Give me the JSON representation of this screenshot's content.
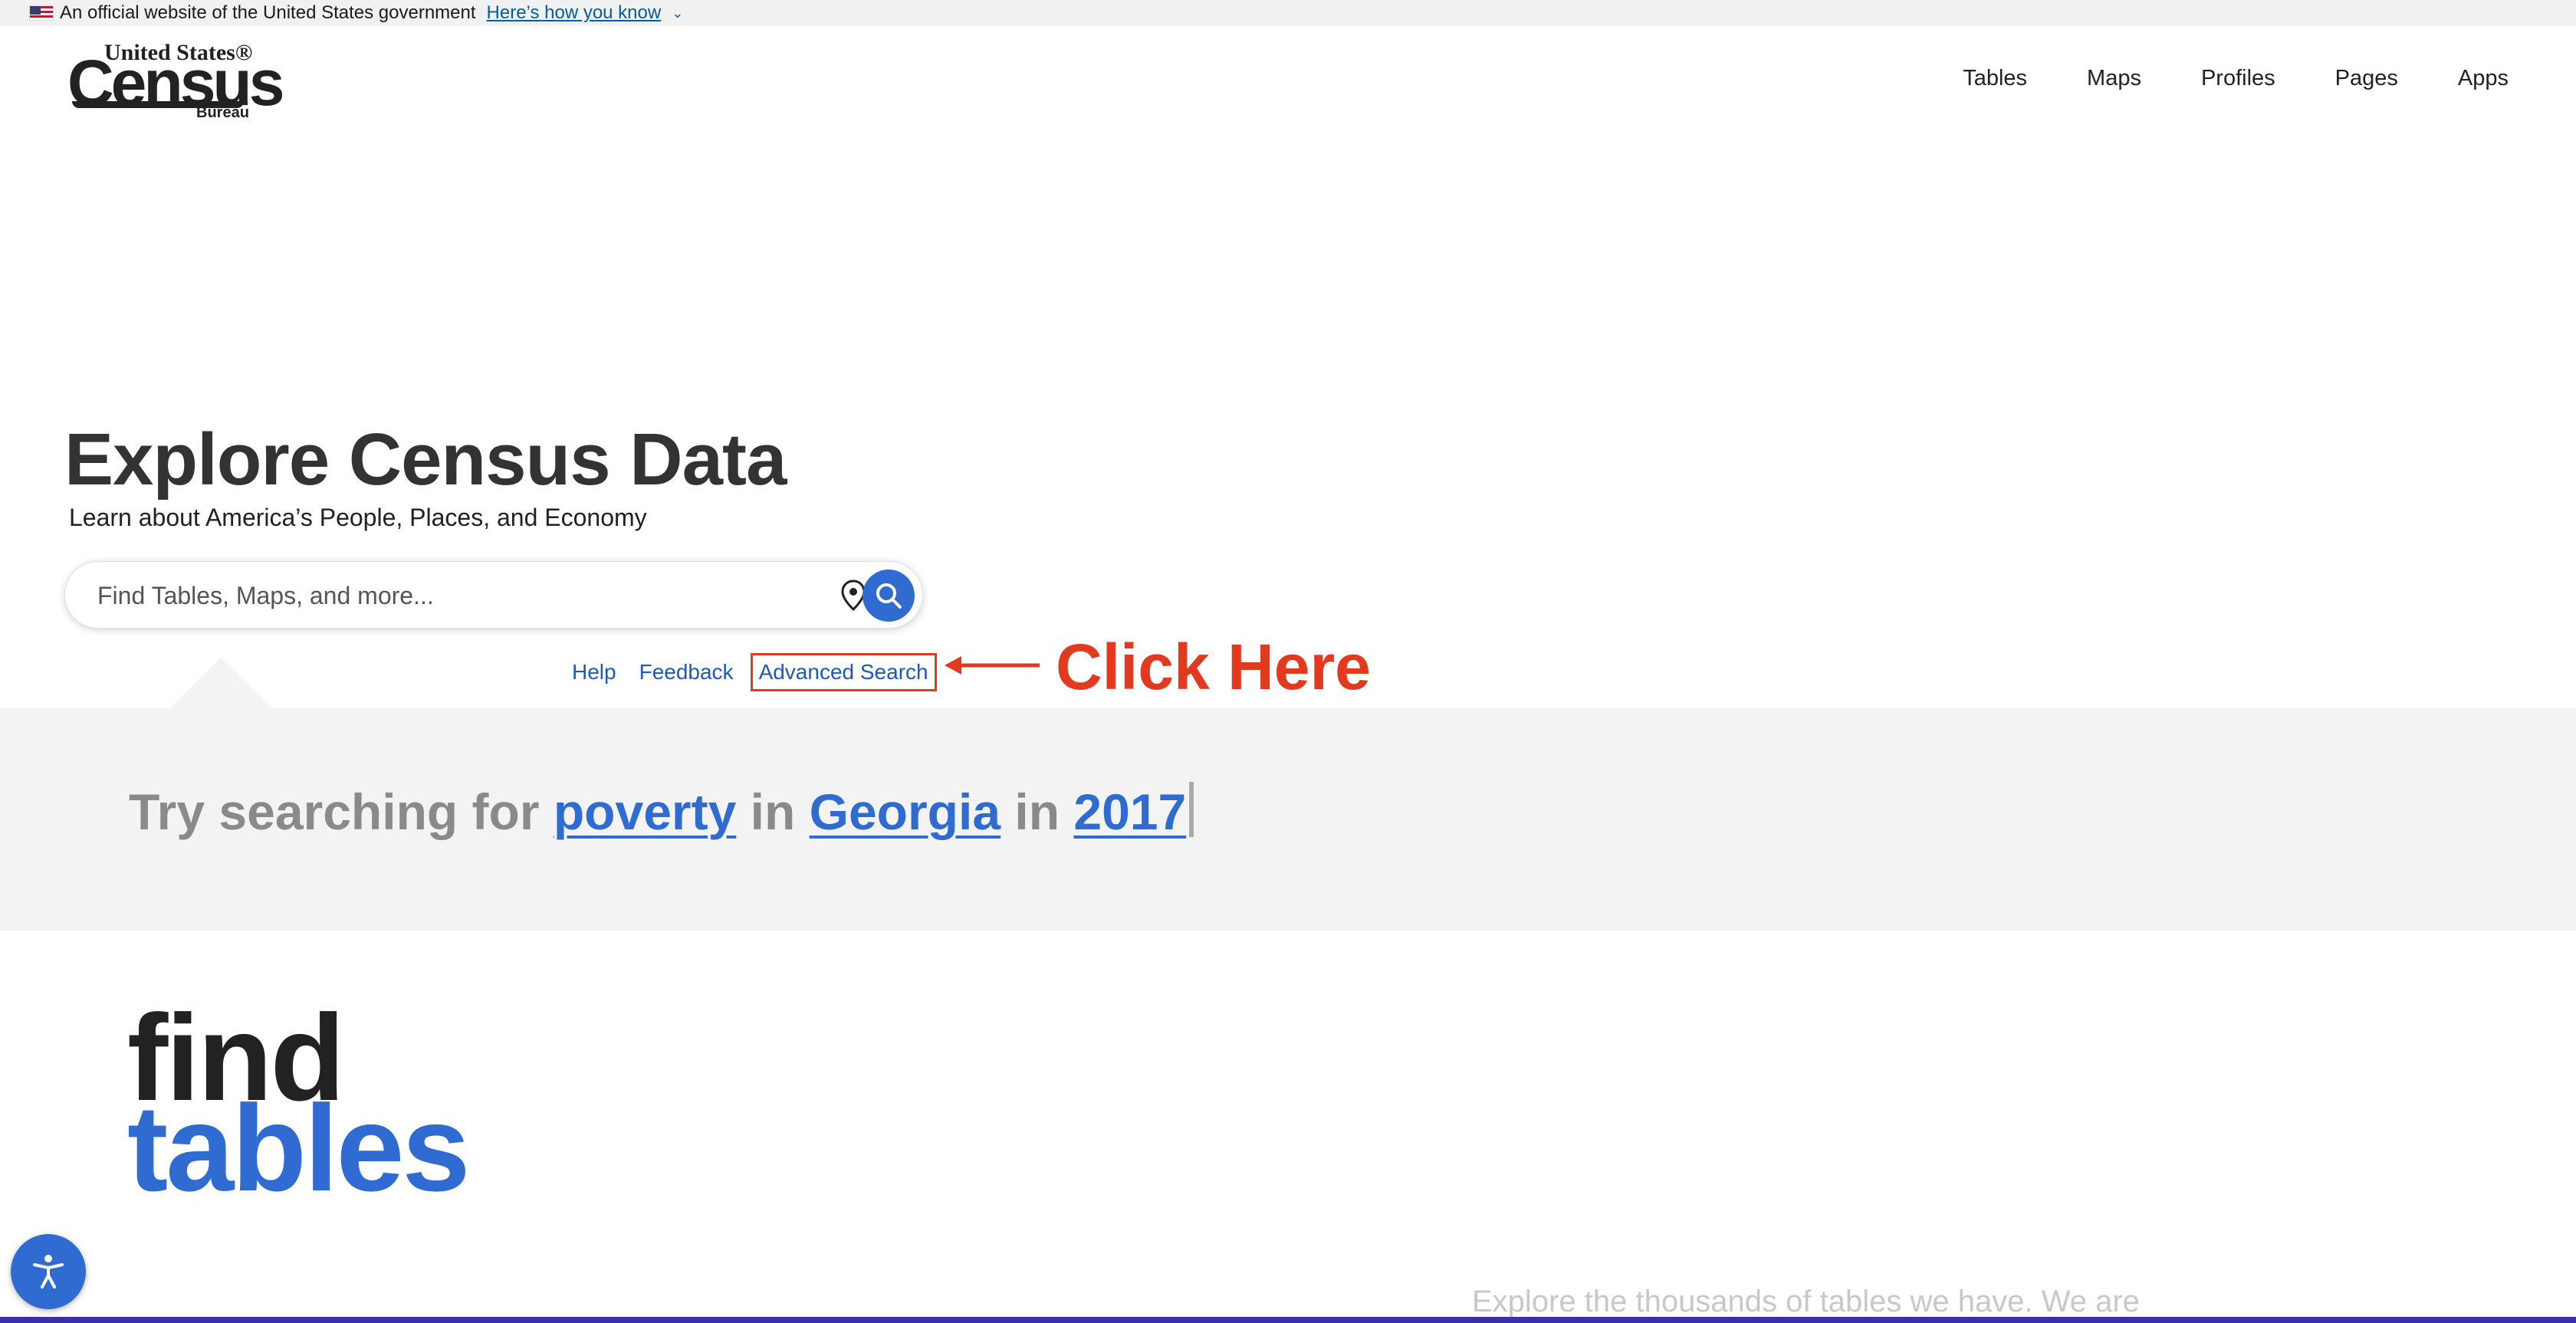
{
  "gov_banner": {
    "text": "An official website of the United States government",
    "link": "Here’s how you know",
    "chevron_icon": "chevron-down-icon"
  },
  "logo": {
    "line1": "United States®",
    "line2": "Census",
    "line3": "Bureau"
  },
  "nav": {
    "items": [
      "Tables",
      "Maps",
      "Profiles",
      "Pages",
      "Apps"
    ]
  },
  "hero": {
    "title": "Explore Census Data",
    "subtitle": "Learn about America’s People, Places, and Economy"
  },
  "search": {
    "placeholder": "Find Tables, Maps, and more...",
    "value": "",
    "location_icon": "map-pin-icon",
    "search_icon": "search-icon"
  },
  "sub_links": {
    "help": "Help",
    "feedback": "Feedback",
    "advanced": "Advanced Search"
  },
  "annotation": {
    "label": "Click Here",
    "color": "#e23a1e"
  },
  "try_search": {
    "prefix": "Try searching for",
    "topic": "poverty",
    "in1": "in",
    "place": "Georgia",
    "in2": "in",
    "year": "2017"
  },
  "find_section": {
    "word1": "find",
    "word2": "tables",
    "description": "Explore the thousands of tables we have. We are"
  },
  "accessibility": {
    "icon": "accessibility-icon"
  },
  "colors": {
    "accent": "#2f6bd1",
    "annotation": "#e23a1e",
    "band": "#f3f3f3"
  }
}
